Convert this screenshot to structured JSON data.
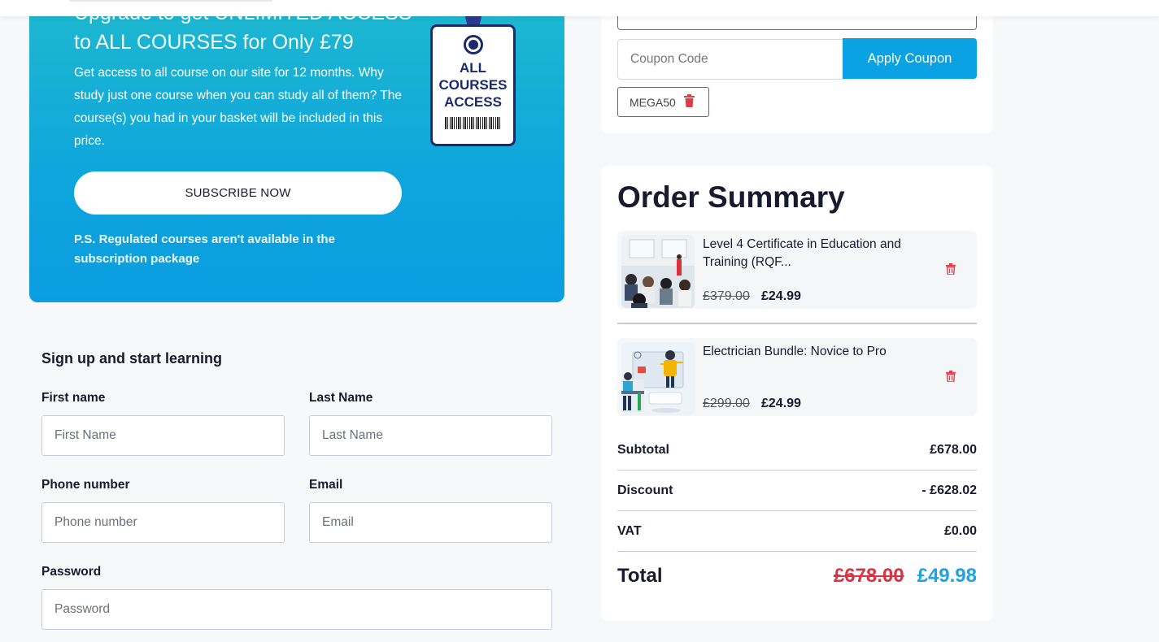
{
  "promo": {
    "title_line1": "Upgrade to get UNLIMITED ACCESS",
    "title_line2": "to ALL COURSES for Only £79",
    "description": "Get access to all course on our site for 12 months. Why study just one course when you can study all of them? The course(s) you had in your basket will be included in this price.",
    "subscribe_label": "SUBSCRIBE NOW",
    "note": "P.S. Regulated courses aren't available in the subscription package",
    "badge_line1": "ALL",
    "badge_line2": "COURSES",
    "badge_line3": "ACCESS",
    "gradient_top": "#1fb9cf",
    "gradient_bottom": "#0b9de0"
  },
  "signup": {
    "title": "Sign up and start learning",
    "first_name_label": "First name",
    "first_name_placeholder": "First Name",
    "last_name_label": "Last Name",
    "last_name_placeholder": "Last Name",
    "phone_label": "Phone number",
    "phone_placeholder": "Phone number",
    "email_label": "Email",
    "email_placeholder": "Email",
    "password_label": "Password",
    "password_placeholder": "Password"
  },
  "coupon": {
    "placeholder": "Coupon Code",
    "apply_label": "Apply Coupon",
    "applied_code": "MEGA50",
    "accent": "#0aa2e3"
  },
  "summary": {
    "title": "Order Summary",
    "items": [
      {
        "title": "Level 4 Certificate in Education and Training (RQF...",
        "old_price": "£379.00",
        "new_price": "£24.99",
        "thumb_icon": "classroom-photo"
      },
      {
        "title": "Electrician Bundle: Novice to Pro",
        "old_price": "£299.00",
        "new_price": "£24.99",
        "thumb_icon": "presenter-illustration"
      }
    ],
    "subtotal_label": "Subtotal",
    "subtotal_value": "£678.00",
    "discount_label": "Discount",
    "discount_value": "- £628.02",
    "vat_label": "VAT",
    "vat_value": "£0.00",
    "total_label": "Total",
    "total_old": "£678.00",
    "total_new": "£49.98",
    "total_old_color": "#d93242",
    "total_new_color": "#1ea2e3"
  }
}
